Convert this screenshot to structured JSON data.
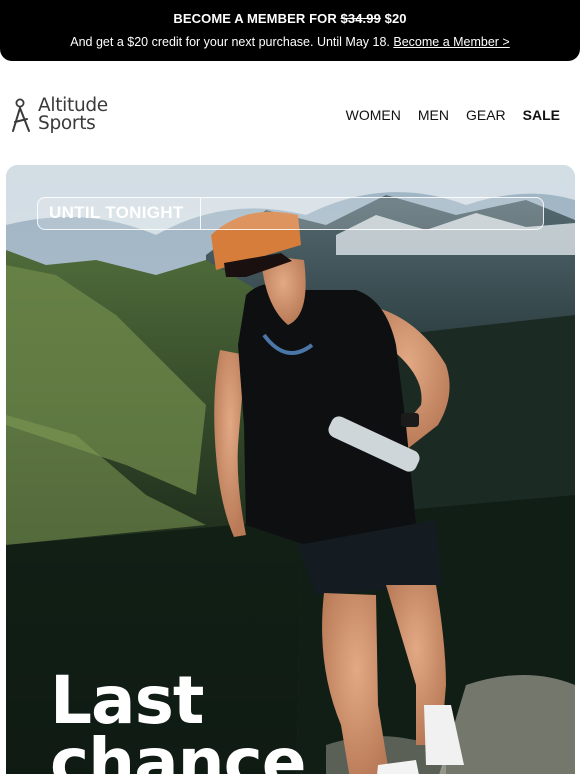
{
  "promo": {
    "headline_prefix": "BECOME A MEMBER FOR ",
    "old_price": "$34.99",
    "new_price": " $20",
    "subtext": "And get a $20 credit for your next purchase. Until May 18. ",
    "link_label": "Become a Member >"
  },
  "brand": {
    "name_line1": "Altitude",
    "name_line2": "Sports",
    "logo_icon": "runner-figure-icon"
  },
  "nav": {
    "items": [
      {
        "label": "WOMEN"
      },
      {
        "label": "MEN"
      },
      {
        "label": "GEAR"
      },
      {
        "label": "SALE"
      }
    ]
  },
  "hero": {
    "countdown_label": "UNTIL TONIGHT",
    "title_line1": "Last",
    "title_line2": "chance"
  },
  "colors": {
    "promo_bg": "#000000",
    "text_dark": "#111111",
    "hero_text": "#ffffff"
  }
}
